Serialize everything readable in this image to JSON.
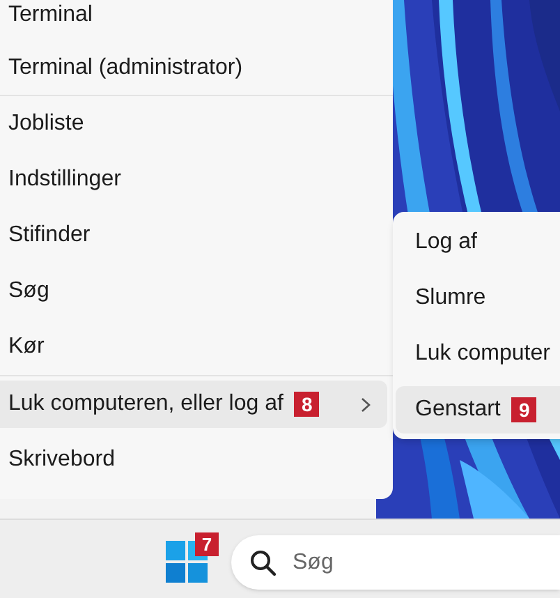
{
  "main_menu": {
    "groups": [
      [
        {
          "label": "Terminal",
          "selected": false
        },
        {
          "label": "Terminal (administrator)",
          "selected": false
        }
      ],
      [
        {
          "label": "Jobliste",
          "selected": false
        },
        {
          "label": "Indstillinger",
          "selected": false
        },
        {
          "label": "Stifinder",
          "selected": false
        },
        {
          "label": "Søg",
          "selected": false
        },
        {
          "label": "Kør",
          "selected": false
        }
      ],
      [
        {
          "label": "Luk computeren, eller log af",
          "selected": true,
          "badge": "8",
          "has_submenu": true
        },
        {
          "label": "Skrivebord",
          "selected": false
        }
      ]
    ]
  },
  "submenu": {
    "items": [
      {
        "label": "Log af",
        "selected": false
      },
      {
        "label": "Slumre",
        "selected": false
      },
      {
        "label": "Luk computer",
        "selected": false
      },
      {
        "label": "Genstart",
        "selected": true,
        "badge": "9"
      }
    ]
  },
  "taskbar": {
    "start_badge": "7",
    "search": {
      "placeholder": "Søg"
    }
  }
}
